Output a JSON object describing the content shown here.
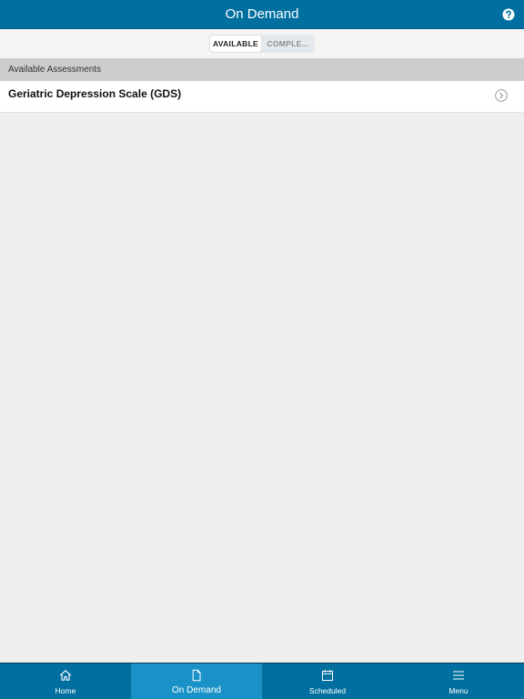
{
  "header": {
    "title": "On Demand",
    "help_icon": "question-circle-icon"
  },
  "segments": {
    "available": "AVAILABLE",
    "completed": "COMPLE..."
  },
  "section": {
    "title": "Available Assessments"
  },
  "assessments": [
    {
      "title": "Geriatric Depression Scale (GDS)",
      "icon": "chevron-right-circle-icon"
    }
  ],
  "tabbar": {
    "items": [
      {
        "label": "Home",
        "icon": "home-icon",
        "active": false
      },
      {
        "label": "On Demand",
        "icon": "document-icon",
        "active": true
      },
      {
        "label": "Scheduled",
        "icon": "calendar-icon",
        "active": false
      },
      {
        "label": "Menu",
        "icon": "hamburger-menu-icon",
        "active": false
      }
    ]
  },
  "colors": {
    "brand": "#0170a0",
    "active_tab": "#1a92c8",
    "background": "#efefef"
  }
}
